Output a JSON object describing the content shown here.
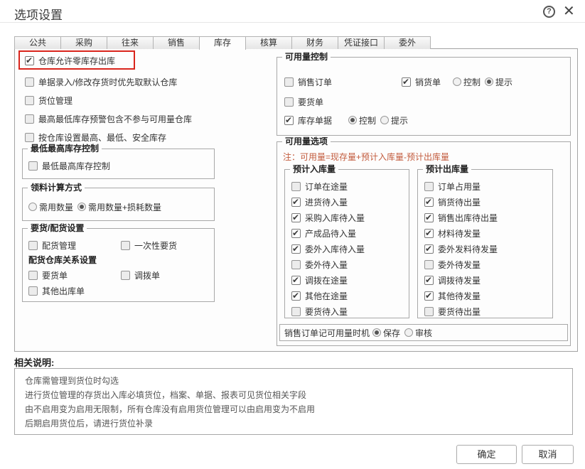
{
  "window": {
    "title": "选项设置",
    "help_glyph": "?",
    "close_glyph": "✕"
  },
  "tabs": [
    {
      "label": "公共",
      "active": false
    },
    {
      "label": "采购",
      "active": false
    },
    {
      "label": "往来",
      "active": false
    },
    {
      "label": "销售",
      "active": false
    },
    {
      "label": "库存",
      "active": true
    },
    {
      "label": "核算",
      "active": false
    },
    {
      "label": "财务",
      "active": false
    },
    {
      "label": "凭证接口",
      "active": false
    },
    {
      "label": "委外",
      "active": false
    }
  ],
  "left": {
    "top_checks": [
      {
        "label": "仓库允许零库存出库",
        "checked": true,
        "highlighted": true
      },
      {
        "label": "单据录入/修改存货时优先取默认仓库",
        "checked": false
      },
      {
        "label": "货位管理",
        "checked": false
      },
      {
        "label": "最高最低库存预警包含不参与可用量仓库",
        "checked": false
      },
      {
        "label": "按仓库设置最高、最低、安全库存",
        "checked": false
      }
    ],
    "minmax_group": {
      "legend": "最低最高库存控制",
      "check": {
        "label": "最低最高库存控制",
        "checked": false
      }
    },
    "material_group": {
      "legend": "领料计算方式",
      "radios": [
        {
          "label": "需用数量",
          "on": false
        },
        {
          "label": "需用数量+损耗数量",
          "on": true
        }
      ]
    },
    "delivery_group": {
      "legend": "要货/配货设置",
      "row1": [
        {
          "label": "配货管理",
          "checked": false
        },
        {
          "label": "一次性要货",
          "checked": false
        }
      ],
      "subheading": "配货仓库关系设置",
      "row2": [
        {
          "label": "要货单",
          "checked": false
        },
        {
          "label": "调拨单",
          "checked": false
        }
      ],
      "row3": [
        {
          "label": "其他出库单",
          "checked": false
        }
      ]
    }
  },
  "right": {
    "avail_control": {
      "legend": "可用量控制",
      "sales_order": {
        "label": "销售订单",
        "checked": false
      },
      "sales_invoice": {
        "label": "销货单",
        "checked": true
      },
      "sales_invoice_radios": [
        {
          "label": "控制",
          "on": false
        },
        {
          "label": "提示",
          "on": true
        }
      ],
      "demand_order": {
        "label": "要货单",
        "checked": false
      },
      "inventory_doc": {
        "label": "库存单据",
        "checked": true
      },
      "inventory_doc_radios": [
        {
          "label": "控制",
          "on": true
        },
        {
          "label": "提示",
          "on": false
        }
      ]
    },
    "avail_options": {
      "legend": "可用量选项",
      "note": "注：可用量=现存量+预计入库量-预计出库量",
      "inbound": {
        "legend": "预计入库量",
        "items": [
          {
            "label": "订单在途量",
            "checked": false
          },
          {
            "label": "进货待入量",
            "checked": true
          },
          {
            "label": "采购入库待入量",
            "checked": true
          },
          {
            "label": "产成品待入量",
            "checked": true
          },
          {
            "label": "委外入库待入量",
            "checked": true
          },
          {
            "label": "委外待入量",
            "checked": false
          },
          {
            "label": "调拨在途量",
            "checked": true
          },
          {
            "label": "其他在途量",
            "checked": true
          },
          {
            "label": "要货待入量",
            "checked": false
          }
        ]
      },
      "outbound": {
        "legend": "预计出库量",
        "items": [
          {
            "label": "订单占用量",
            "checked": false
          },
          {
            "label": "销货待出量",
            "checked": true
          },
          {
            "label": "销售出库待出量",
            "checked": true
          },
          {
            "label": "材料待发量",
            "checked": true
          },
          {
            "label": "委外发料待发量",
            "checked": true
          },
          {
            "label": "委外待发量",
            "checked": false
          },
          {
            "label": "调拨待发量",
            "checked": true
          },
          {
            "label": "其他待发量",
            "checked": true
          },
          {
            "label": "要货待出量",
            "checked": false
          }
        ]
      },
      "timing": {
        "label": "销售订单记可用量时机",
        "radios": [
          {
            "label": "保存",
            "on": true
          },
          {
            "label": "审核",
            "on": false
          }
        ]
      }
    }
  },
  "notes": {
    "title": "相关说明:",
    "lines": [
      "仓库需管理到货位时勾选",
      "进行货位管理的存货出入库必填货位，档案、单据、报表可见货位相关字段",
      "由不启用变为启用无限制，所有仓库没有启用货位管理可以由启用变为不启用",
      "后期启用货位后，请进行货位补录"
    ]
  },
  "footer": {
    "ok_label": "确定",
    "cancel_label": "取消"
  },
  "colors": {
    "highlight_red": "#d9251c",
    "note_orange": "#c25b3d"
  }
}
